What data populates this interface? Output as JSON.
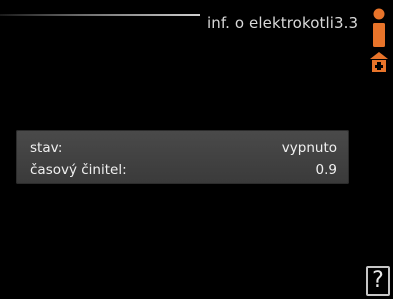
{
  "header": {
    "title": "inf. o elektrokotli3.3"
  },
  "icons": {
    "info": "info-icon",
    "home": "home-icon",
    "help": "help-icon"
  },
  "info_panel": {
    "rows": [
      {
        "label": "stav:",
        "value": "vypnuto"
      },
      {
        "label": "časový činitel:",
        "value": "0.9"
      }
    ]
  },
  "help_button": {
    "label": "?"
  },
  "colors": {
    "background": "#000000",
    "accent": "#e8742a",
    "panel": "#404040",
    "text": "#f0f0f0"
  }
}
